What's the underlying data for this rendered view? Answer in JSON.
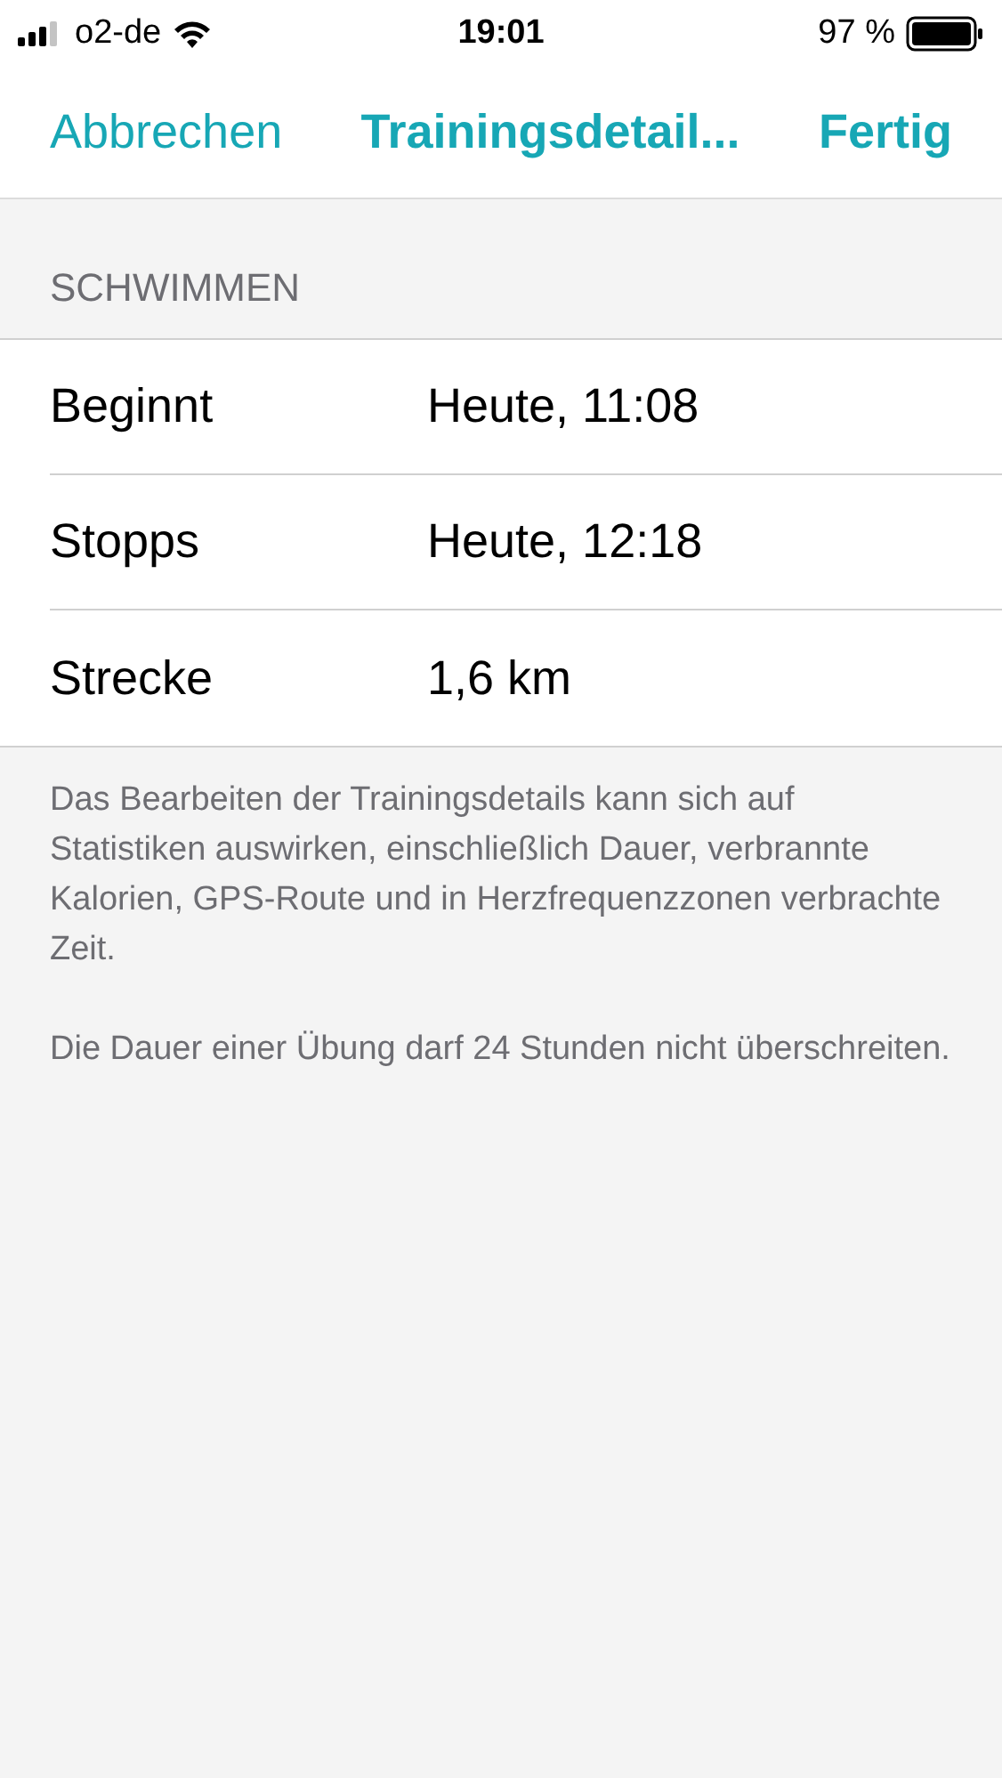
{
  "status_bar": {
    "carrier": "o2-de",
    "time": "19:01",
    "battery": "97 %"
  },
  "nav": {
    "cancel": "Abbrechen",
    "title": "Trainingsdetail...",
    "done": "Fertig"
  },
  "section": {
    "header": "SCHWIMMEN",
    "rows": [
      {
        "label": "Beginnt",
        "value": "Heute, 11:08"
      },
      {
        "label": "Stopps",
        "value": "Heute, 12:18"
      },
      {
        "label": "Strecke",
        "value": "1,6 km"
      }
    ]
  },
  "footer": [
    "Das Bearbeiten der Trainingsdetails kann sich auf Statistiken auswirken, einschließlich Dauer, verbrannte Kalorien, GPS-Route und in Herzfrequenzzonen verbrachte Zeit.",
    "Die Dauer einer Übung darf 24 Stunden nicht überschreiten."
  ]
}
